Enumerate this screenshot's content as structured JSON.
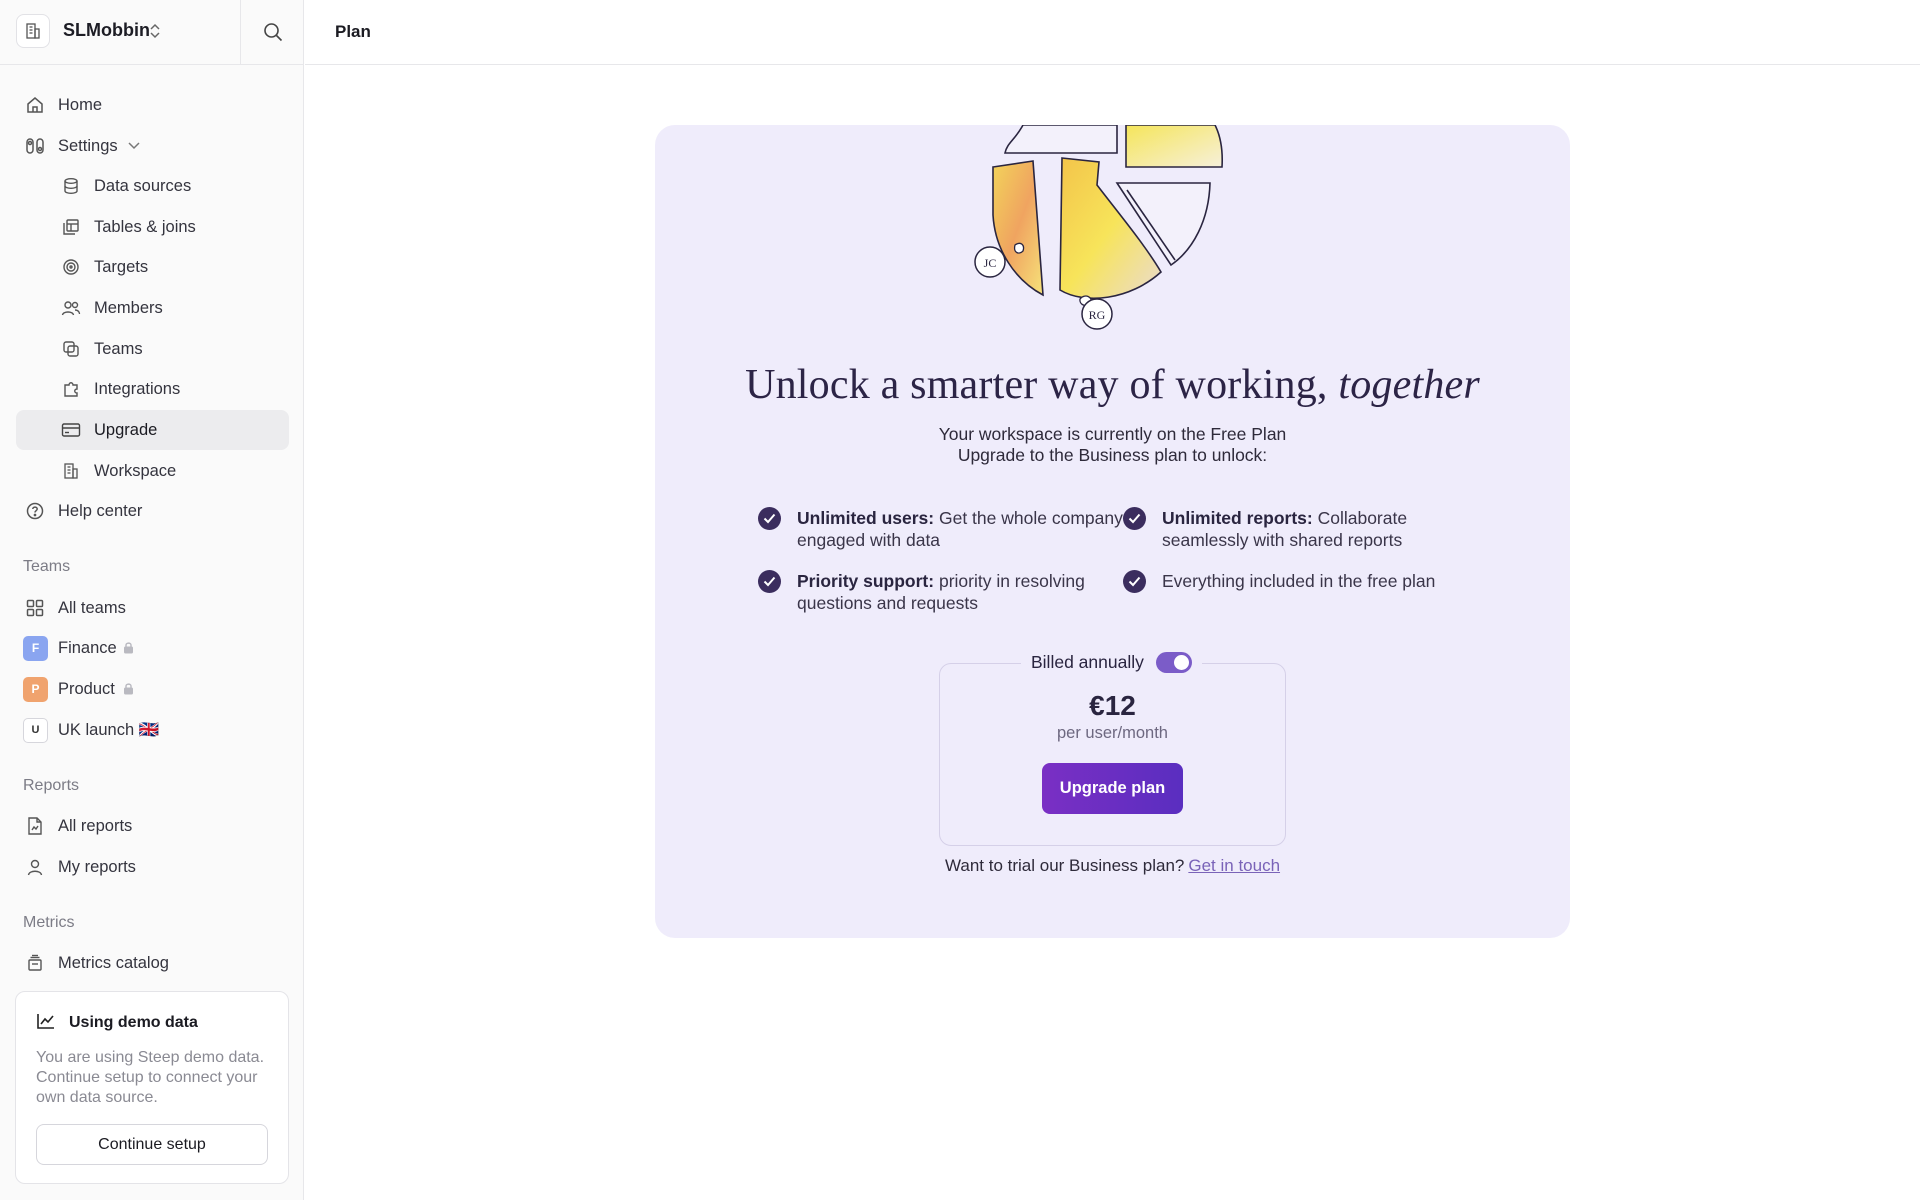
{
  "workspace": {
    "name": "SLMobbin"
  },
  "header": {
    "title": "Plan"
  },
  "nav": {
    "home": "Home",
    "settings": "Settings",
    "data_sources": "Data sources",
    "tables_joins": "Tables & joins",
    "targets": "Targets",
    "members": "Members",
    "teams": "Teams",
    "integrations": "Integrations",
    "upgrade": "Upgrade",
    "workspace": "Workspace",
    "help_center": "Help center"
  },
  "teams_section": {
    "label": "Teams",
    "all_teams": "All teams",
    "items": [
      {
        "badge": "F",
        "label": "Finance",
        "color": "#8aa5f0"
      },
      {
        "badge": "P",
        "label": "Product",
        "color": "#f0a36e"
      },
      {
        "badge": "U",
        "label": "UK launch 🇬🇧",
        "color": "#ffffff"
      }
    ]
  },
  "reports_section": {
    "label": "Reports",
    "all_reports": "All reports",
    "my_reports": "My reports"
  },
  "metrics_section": {
    "label": "Metrics",
    "metrics_catalog": "Metrics catalog"
  },
  "demo": {
    "title": "Using demo data",
    "text": "You are using Steep demo data. Continue setup to connect your own data source.",
    "button": "Continue setup"
  },
  "plan": {
    "headline": "Unlock a smarter way of working,",
    "headline_italic": "together",
    "sub1": "Your workspace is currently on the Free Plan",
    "sub2": "Upgrade to the Business plan to unlock:",
    "features": [
      {
        "bold": "Unlimited users:",
        "text": " Get the whole company engaged with data"
      },
      {
        "bold": "Unlimited reports:",
        "text": " Collaborate seamlessly with shared reports"
      },
      {
        "bold": "Priority support:",
        "text": " priority in resolving questions and requests"
      },
      {
        "bold": "",
        "text": "Everything included in the free plan"
      }
    ],
    "billed": "Billed annually",
    "billed_on": true,
    "price": "€12",
    "per": "per user/month",
    "button": "Upgrade plan",
    "trial_text": "Want to trial our Business plan?",
    "trial_link": "Get in touch",
    "avatars": [
      "JC",
      "RG"
    ]
  },
  "colors": {
    "accent": "#6b3fc4",
    "card_bg": "#efecfb",
    "check": "#3b2d5e"
  }
}
